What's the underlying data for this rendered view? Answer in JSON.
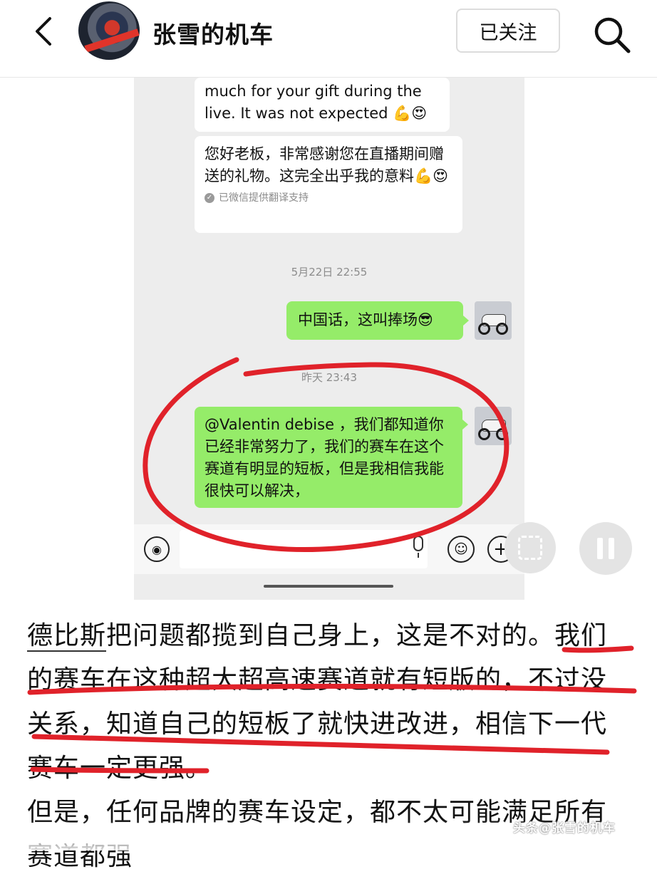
{
  "header": {
    "account_name": "张雪的机车",
    "follow_label": "已关注"
  },
  "chat": {
    "msg_partial_en": "much for your gift during the live. It was not expected 💪😍",
    "msg_translation": "您好老板，非常感谢您在直播期间赠送的礼物。这完全出乎我的意料💪😍",
    "translation_note": "已微信提供翻译支持",
    "time_1": "5月22日 22:55",
    "msg_reply_1": "中国话，这叫捧场😎",
    "time_2": "昨天 23:43",
    "msg_reply_2": "@Valentin debise ，我们都知道你已经非常努力了，我们的赛车在这个赛道有明显的短板，但是我相信我能很快可以解决，"
  },
  "article": {
    "p1_link": "德比斯",
    "p1_text": "把问题都揽到自己身上，这是不对的。我们的赛车在这种超大超高速赛道就有短版的，不过没关系，知道自己的短板了就快进改进，相信下一代赛车一定更强。",
    "p2_text": "但是，任何品牌的赛车设定，都不太可能满足所有赛道都强"
  },
  "watermark": "头条@张雪的机车",
  "colors": {
    "sent_bubble": "#95ec69",
    "received_bubble": "#ffffff",
    "chat_bg": "#ededed",
    "annotation_red": "#e0222a"
  },
  "icons": [
    "back-arrow-icon",
    "search-icon",
    "voice-icon",
    "mic-icon",
    "emoji-icon",
    "plus-icon",
    "lens-search-icon",
    "pause-icon"
  ]
}
